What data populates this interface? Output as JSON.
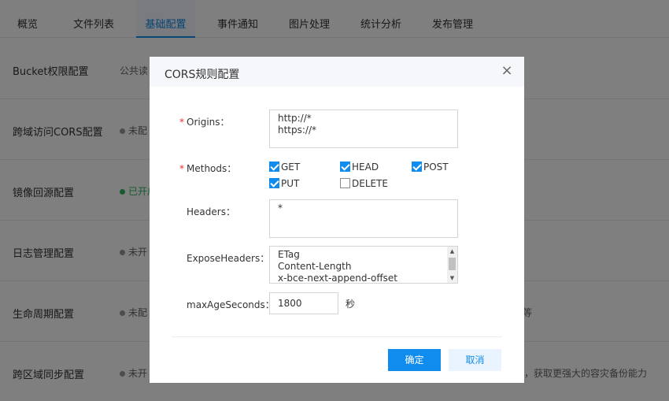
{
  "tabs": [
    {
      "label": "概览"
    },
    {
      "label": "文件列表"
    },
    {
      "label": "基础配置"
    },
    {
      "label": "事件通知"
    },
    {
      "label": "图片处理"
    },
    {
      "label": "统计分析"
    },
    {
      "label": "发布管理"
    }
  ],
  "rows": [
    {
      "title": "Bucket权限配置",
      "status": "公共读"
    },
    {
      "title": "跨域访问CORS配置",
      "status": "未配"
    },
    {
      "title": "镜像回源配置",
      "status": "已开启"
    },
    {
      "title": "日志管理配置",
      "status": "未开"
    },
    {
      "title": "生命周期配置",
      "status": "未配",
      "extra": "等"
    },
    {
      "title": "跨区域同步配置",
      "status": "未开",
      "extra": "，获取更强大的容灾备份能力"
    }
  ],
  "dialog": {
    "title": "CORS规则配置",
    "close_icon": "×",
    "origins": {
      "label": "Origins：",
      "required": "*",
      "lines": [
        "http://*",
        "https://*"
      ]
    },
    "methods": {
      "label": "Methods：",
      "required": "*",
      "options": [
        {
          "label": "GET",
          "checked": true
        },
        {
          "label": "HEAD",
          "checked": true
        },
        {
          "label": "POST",
          "checked": true
        },
        {
          "label": "PUT",
          "checked": true
        },
        {
          "label": "DELETE",
          "checked": false
        }
      ]
    },
    "headers": {
      "label": "Headers：",
      "lines": [
        "*"
      ]
    },
    "expose_headers": {
      "label": "ExposeHeaders：",
      "lines": [
        "ETag",
        "Content-Length",
        "x-bce-next-append-offset"
      ]
    },
    "max_age": {
      "label": "maxAgeSeconds：",
      "value": "1800",
      "unit": "秒"
    },
    "confirm_label": "确定",
    "cancel_label": "取消"
  },
  "colors": {
    "accent": "#108cee",
    "required": "#ea2e2e",
    "enabled": "#2cb663"
  }
}
